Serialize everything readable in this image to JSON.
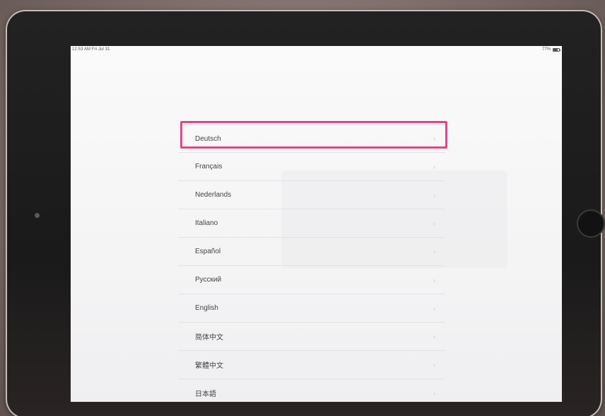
{
  "status_bar": {
    "time": "12:53 AM  Fri Jul 31",
    "battery_percent": "77%",
    "battery_level": 0.77
  },
  "languages": [
    "Deutsch",
    "Français",
    "Nederlands",
    "Italiano",
    "Español",
    "Русский",
    "English",
    "简体中文",
    "繁體中文",
    "日本語"
  ],
  "highlighted_index": 0,
  "chevron_glyph": "›",
  "colors": {
    "highlight": "#e2458a",
    "screen_bg": "#f7f7f8",
    "text": "#444444"
  }
}
